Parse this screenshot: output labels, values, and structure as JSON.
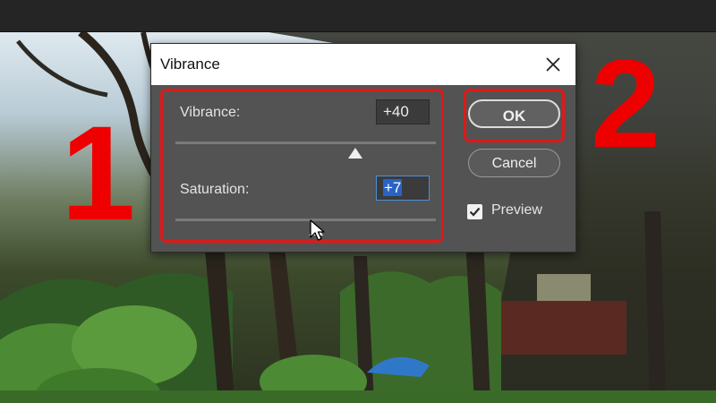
{
  "dialog": {
    "title": "Vibrance",
    "vibrance": {
      "label": "Vibrance:",
      "value": "+40",
      "slider_fraction": 0.69
    },
    "saturation": {
      "label": "Saturation:",
      "value": "+7",
      "slider_fraction": 0.54
    },
    "ok_label": "OK",
    "cancel_label": "Cancel",
    "preview": {
      "label": "Preview",
      "checked": true
    }
  },
  "annotations": {
    "marker_1": "1",
    "marker_2": "2",
    "highlight_color": "#e01919"
  },
  "icons": [
    "close-icon",
    "checkmark-icon",
    "mouse-pointer-icon"
  ]
}
